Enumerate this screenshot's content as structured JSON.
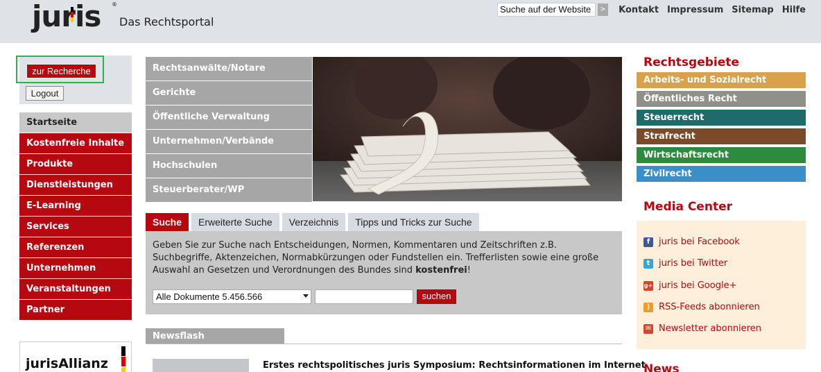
{
  "header": {
    "logo_text": "juris",
    "logo_reg": "®",
    "tagline": "Das Rechtsportal",
    "site_search_value": "Suche auf der Website",
    "site_search_button": ">",
    "links": [
      "Kontakt",
      "Impressum",
      "Sitemap",
      "Hilfe"
    ]
  },
  "left": {
    "recherche_label": "zur Recherche",
    "logout_label": "Logout",
    "nav": [
      {
        "label": "Startseite",
        "active": true
      },
      {
        "label": "Kostenfreie Inhalte"
      },
      {
        "label": "Produkte"
      },
      {
        "label": "Dienstleistungen"
      },
      {
        "label": "E-Learning"
      },
      {
        "label": "Services"
      },
      {
        "label": "Referenzen"
      },
      {
        "label": "Unternehmen"
      },
      {
        "label": "Veranstaltungen"
      },
      {
        "label": "Partner"
      }
    ],
    "allianz_text": "jurisAllianz"
  },
  "center": {
    "targets": [
      "Rechtsanwälte/Notare",
      "Gerichte",
      "Öffentliche Verwaltung",
      "Unternehmen/Verbände",
      "Hochschulen",
      "Steuerberater/WP"
    ],
    "tabs": [
      {
        "label": "Suche",
        "active": true
      },
      {
        "label": "Erweiterte Suche"
      },
      {
        "label": "Verzeichnis"
      },
      {
        "label": "Tipps und Tricks zur Suche"
      }
    ],
    "search_desc_1": "Geben Sie zur Suche nach Entscheidungen, Normen, Kommentaren und Zeitschriften z.B. Suchbegriffe, Aktenzeichen, Normabkürzungen oder Fundstellen ein. Trefferlisten sowie eine große Auswahl an Gesetzen und Verordnungen des Bundes sind ",
    "search_desc_bold": "kostenfrei",
    "search_desc_end": "!",
    "doc_select_value": "Alle Dokumente   5.456.566",
    "search_button": "suchen",
    "newsflash_label": "Newsflash",
    "news_headline": "Erstes rechtspolitisches juris Symposium: Rechtsinformationen im Internet"
  },
  "right": {
    "rg_title": "Rechtsgebiete",
    "rg_items": [
      {
        "label": "Arbeits- und Sozialrecht",
        "color": "#d9a24a"
      },
      {
        "label": "Öffentliches Recht",
        "color": "#8f908a"
      },
      {
        "label": "Steuerrecht",
        "color": "#1f6b6b"
      },
      {
        "label": "Strafrecht",
        "color": "#7a4a2a"
      },
      {
        "label": "Wirtschaftsrecht",
        "color": "#2e8b3e"
      },
      {
        "label": "Zivilrecht",
        "color": "#3a8fc8"
      }
    ],
    "media_title": "Media Center",
    "media_items": [
      {
        "label": "juris bei Facebook",
        "icon": "facebook-icon",
        "glyph": "f",
        "color": "#3b5998"
      },
      {
        "label": "juris bei Twitter",
        "icon": "twitter-icon",
        "glyph": "t",
        "color": "#3aa3d8"
      },
      {
        "label": "juris bei Google+",
        "icon": "google-plus-icon",
        "glyph": "g+",
        "color": "#d6442e"
      },
      {
        "label": "RSS-Feeds abonnieren",
        "icon": "rss-icon",
        "glyph": ")",
        "color": "#f09a2a"
      },
      {
        "label": "Newsletter abonnieren",
        "icon": "mail-icon",
        "glyph": "✉",
        "color": "#d6442e"
      }
    ],
    "news_title": "News"
  }
}
